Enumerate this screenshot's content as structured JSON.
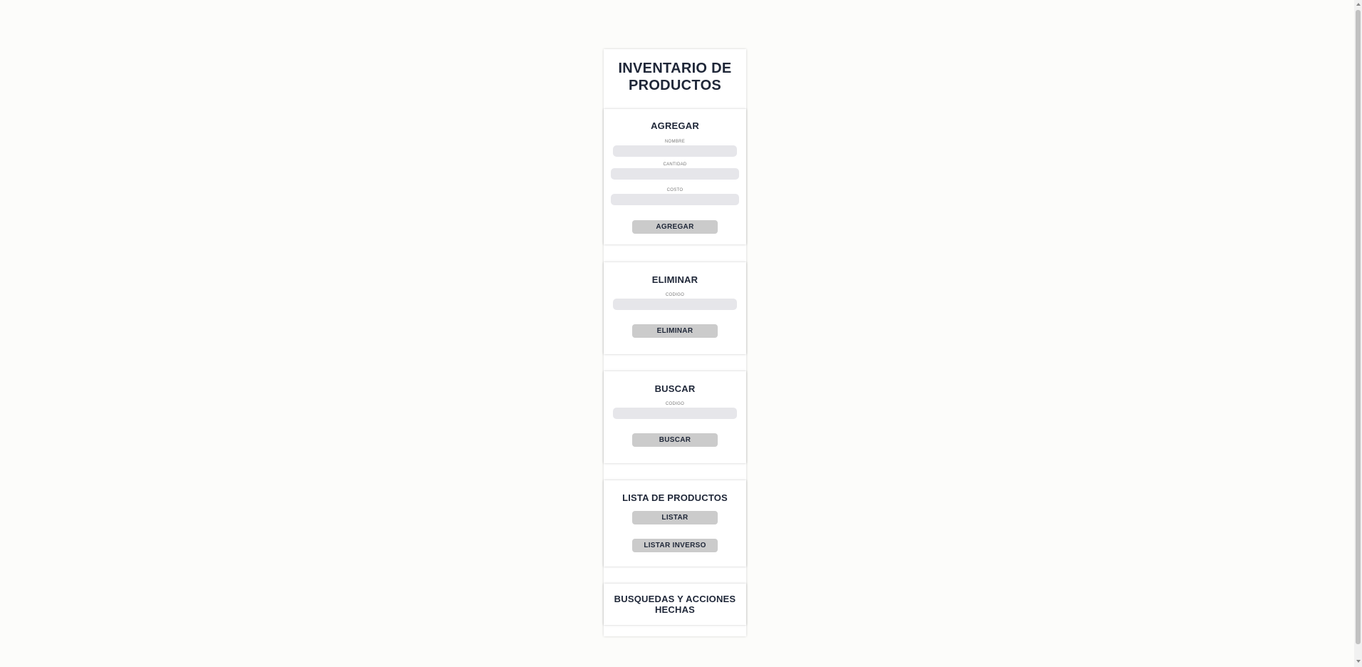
{
  "title": "INVENTARIO DE PRODUCTOS",
  "agregar": {
    "heading": "AGREGAR",
    "nombre_label": "NOMBRE",
    "nombre_value": "",
    "cantidad_label": "CANTIDAD",
    "cantidad_value": "",
    "costo_label": "COSTO",
    "costo_value": "",
    "button": "AGREGAR"
  },
  "eliminar": {
    "heading": "ELIMINAR",
    "codigo_label": "CODIGO",
    "codigo_value": "",
    "button": "ELIMINAR"
  },
  "buscar": {
    "heading": "BUSCAR",
    "codigo_label": "CODIGO",
    "codigo_value": "",
    "button": "BUSCAR"
  },
  "lista": {
    "heading": "LISTA DE PRODUCTOS",
    "listar_button": "LISTAR",
    "listar_inverso_button": "LISTAR INVERSO"
  },
  "historial": {
    "heading": "BUSQUEDAS Y ACCIONES HECHAS"
  },
  "colors": {
    "background": "#fcfcfa",
    "text": "#1f2738",
    "field": "#e6e6ea",
    "button": "#cbcbcb"
  }
}
